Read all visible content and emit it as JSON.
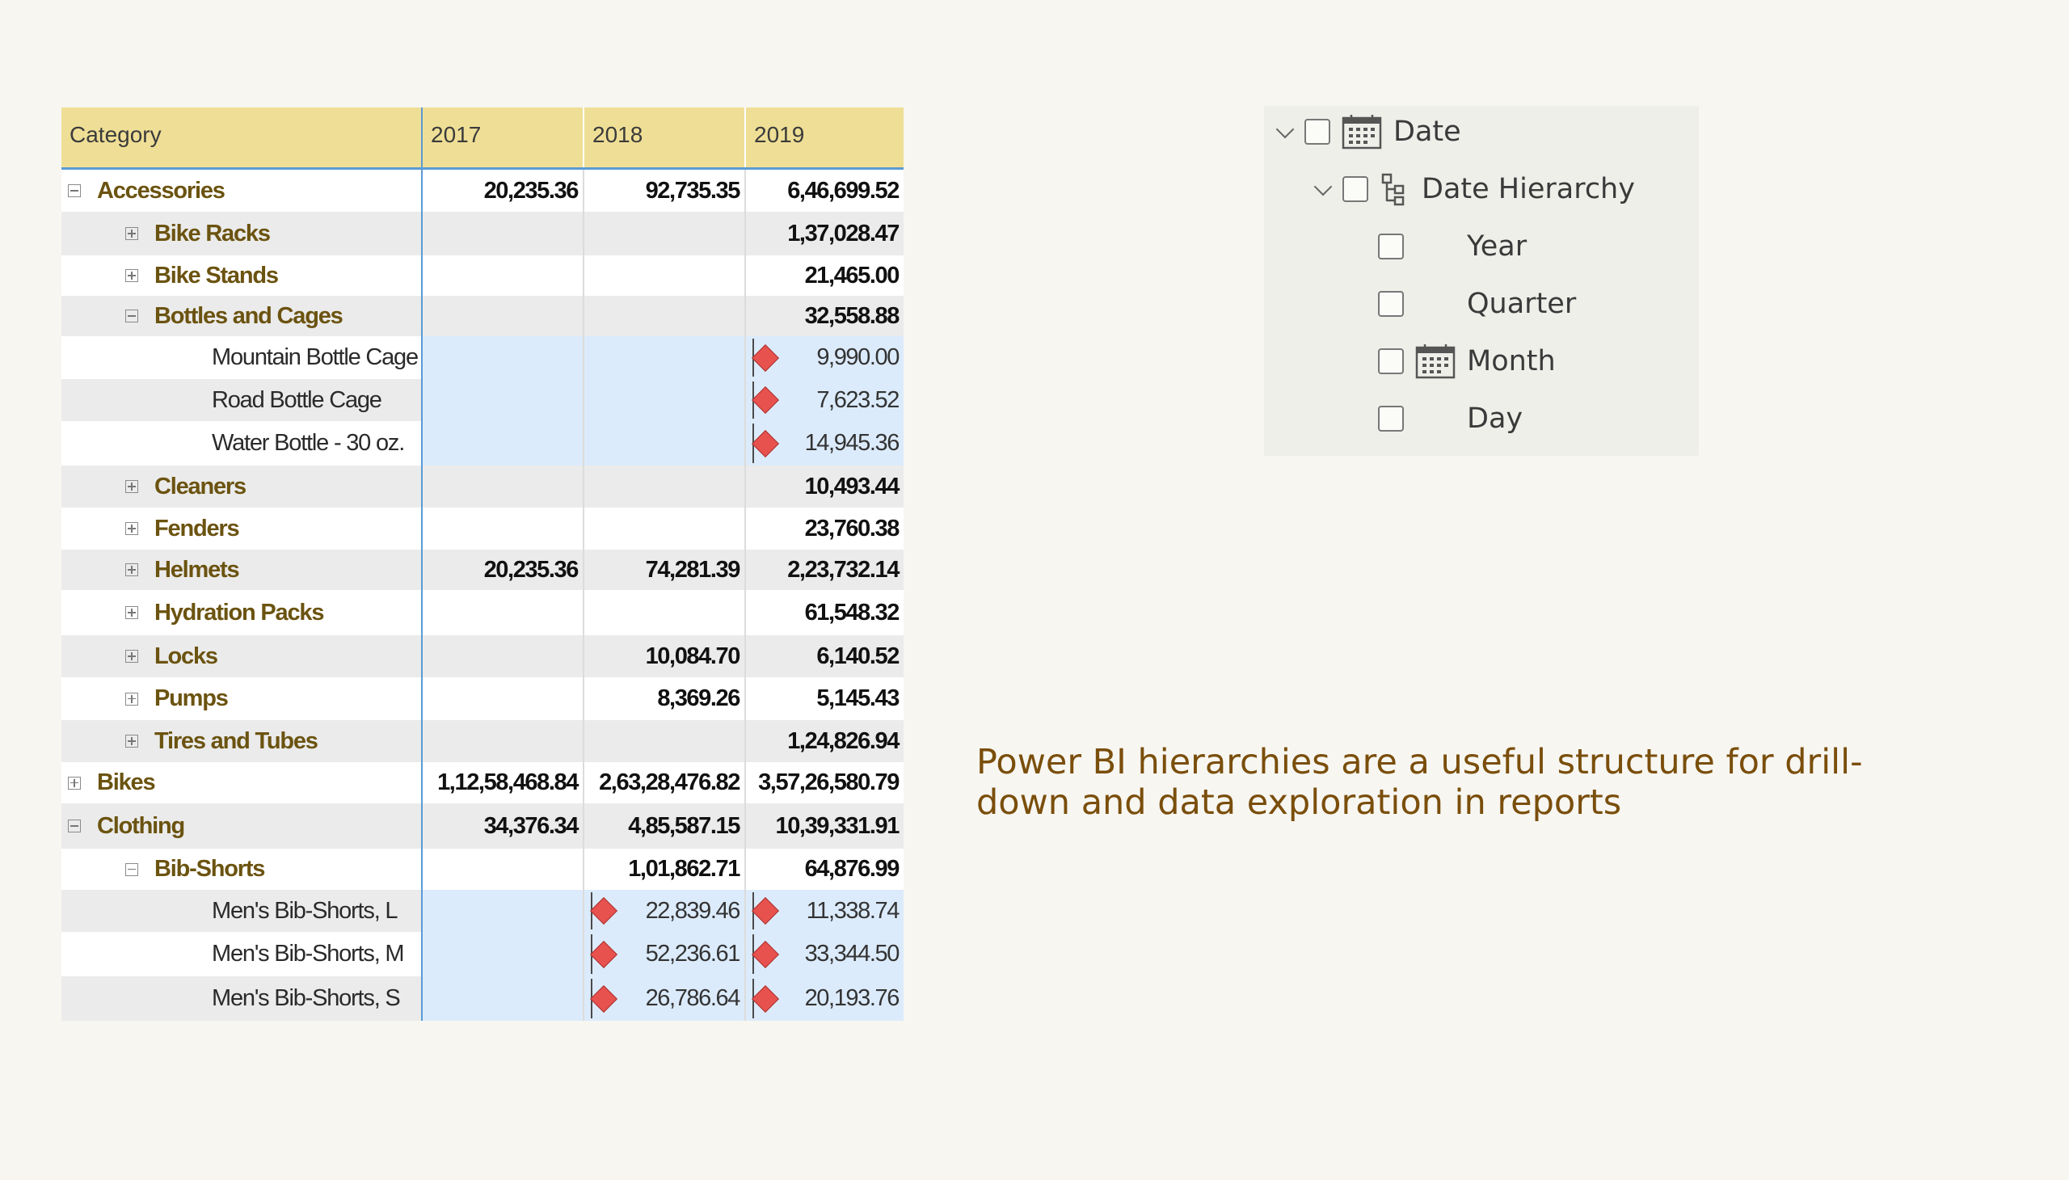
{
  "matrix": {
    "headers": [
      "Category",
      "2017",
      "2018",
      "2019"
    ],
    "rows": [
      {
        "label": "Accessories",
        "level": 0,
        "toggle": "minus",
        "bold": true,
        "v2017": "20,235.36",
        "v2018": "92,735.35",
        "v2019": "6,46,699.52"
      },
      {
        "label": "Bike Racks",
        "level": 1,
        "toggle": "plus",
        "bold": true,
        "v2017": "",
        "v2018": "",
        "v2019": "1,37,028.47"
      },
      {
        "label": "Bike Stands",
        "level": 1,
        "toggle": "plus",
        "bold": true,
        "v2017": "",
        "v2018": "",
        "v2019": "21,465.00"
      },
      {
        "label": "Bottles and Cages",
        "level": 1,
        "toggle": "minus",
        "bold": true,
        "v2017": "",
        "v2018": "",
        "v2019": "32,558.88"
      },
      {
        "label": "Mountain Bottle Cage",
        "level": 2,
        "toggle": "",
        "bold": false,
        "v2017": "",
        "v2018": "",
        "v2019": "9,990.00",
        "kpi2019": true
      },
      {
        "label": "Road Bottle Cage",
        "level": 2,
        "toggle": "",
        "bold": false,
        "v2017": "",
        "v2018": "",
        "v2019": "7,623.52",
        "kpi2019": true
      },
      {
        "label": "Water Bottle - 30 oz.",
        "level": 2,
        "toggle": "",
        "bold": false,
        "v2017": "",
        "v2018": "",
        "v2019": "14,945.36",
        "kpi2019": true
      },
      {
        "label": "Cleaners",
        "level": 1,
        "toggle": "plus",
        "bold": true,
        "v2017": "",
        "v2018": "",
        "v2019": "10,493.44"
      },
      {
        "label": "Fenders",
        "level": 1,
        "toggle": "plus",
        "bold": true,
        "v2017": "",
        "v2018": "",
        "v2019": "23,760.38"
      },
      {
        "label": "Helmets",
        "level": 1,
        "toggle": "plus",
        "bold": true,
        "v2017": "20,235.36",
        "v2018": "74,281.39",
        "v2019": "2,23,732.14"
      },
      {
        "label": "Hydration Packs",
        "level": 1,
        "toggle": "plus",
        "bold": true,
        "v2017": "",
        "v2018": "",
        "v2019": "61,548.32"
      },
      {
        "label": "Locks",
        "level": 1,
        "toggle": "plus",
        "bold": true,
        "v2017": "",
        "v2018": "10,084.70",
        "v2019": "6,140.52"
      },
      {
        "label": "Pumps",
        "level": 1,
        "toggle": "plus",
        "bold": true,
        "v2017": "",
        "v2018": "8,369.26",
        "v2019": "5,145.43"
      },
      {
        "label": "Tires and Tubes",
        "level": 1,
        "toggle": "plus",
        "bold": true,
        "v2017": "",
        "v2018": "",
        "v2019": "1,24,826.94"
      },
      {
        "label": "Bikes",
        "level": 0,
        "toggle": "plus",
        "bold": true,
        "v2017": "1,12,58,468.84",
        "v2018": "2,63,28,476.82",
        "v2019": "3,57,26,580.79"
      },
      {
        "label": "Clothing",
        "level": 0,
        "toggle": "minus",
        "bold": true,
        "v2017": "34,376.34",
        "v2018": "4,85,587.15",
        "v2019": "10,39,331.91"
      },
      {
        "label": "Bib-Shorts",
        "level": 1,
        "toggle": "minus",
        "bold": true,
        "v2017": "",
        "v2018": "1,01,862.71",
        "v2019": "64,876.99"
      },
      {
        "label": "Men's Bib-Shorts, L",
        "level": 2,
        "toggle": "",
        "bold": false,
        "v2017": "",
        "v2018": "22,839.46",
        "v2019": "11,338.74",
        "kpi2018": true,
        "kpi2019": true
      },
      {
        "label": "Men's Bib-Shorts, M",
        "level": 2,
        "toggle": "",
        "bold": false,
        "v2017": "",
        "v2018": "52,236.61",
        "v2019": "33,344.50",
        "kpi2018": true,
        "kpi2019": true
      },
      {
        "label": "Men's Bib-Shorts, S",
        "level": 2,
        "toggle": "",
        "bold": false,
        "v2017": "",
        "v2018": "26,786.64",
        "v2019": "20,193.76",
        "kpi2018": true,
        "kpi2019": true
      }
    ]
  },
  "fields": {
    "date": {
      "label": "Date",
      "icon": "calendar-icon"
    },
    "hierarchy": {
      "label": "Date Hierarchy",
      "icon": "hierarchy-icon"
    },
    "levels": [
      {
        "label": "Year",
        "icon": ""
      },
      {
        "label": "Quarter",
        "icon": ""
      },
      {
        "label": "Month",
        "icon": "calendar-icon"
      },
      {
        "label": "Day",
        "icon": ""
      }
    ]
  },
  "caption": "Power BI hierarchies are a useful structure for drill-down and data exploration in reports",
  "colors": {
    "header_bg": "#efdf96",
    "accent_line": "#5b9bd5",
    "kpi_diamond": "#e8524e",
    "caption_text": "#7a4e0b",
    "highlight_cell": "#dcebfb"
  }
}
